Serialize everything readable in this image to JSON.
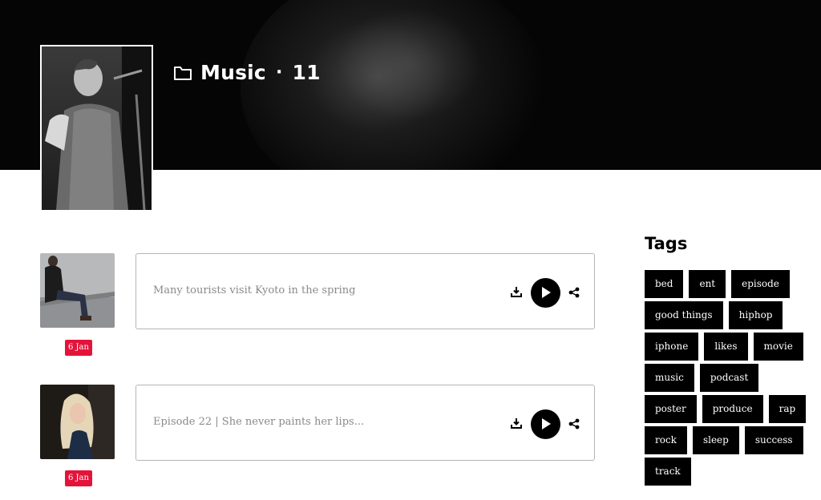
{
  "header": {
    "title": "Music",
    "separator": "·",
    "count": "11",
    "icon": "folder-icon"
  },
  "episodes": [
    {
      "title": "Many tourists visit Kyoto in the spring",
      "date": "6 Jan",
      "thumb": "man-sitting-photo"
    },
    {
      "title": "Episode 22 | She never paints her lips...",
      "date": "6 Jan",
      "thumb": "blonde-woman-photo"
    }
  ],
  "sidebar": {
    "heading": "Tags",
    "tags": [
      "bed",
      "ent",
      "episode",
      "good things",
      "hiphop",
      "iphone",
      "likes",
      "movie",
      "music",
      "podcast",
      "poster",
      "produce",
      "rap",
      "rock",
      "sleep",
      "success",
      "track"
    ]
  },
  "colors": {
    "accent": "#e4133a",
    "tag_bg": "#000000",
    "hero_bg": "#050505"
  }
}
